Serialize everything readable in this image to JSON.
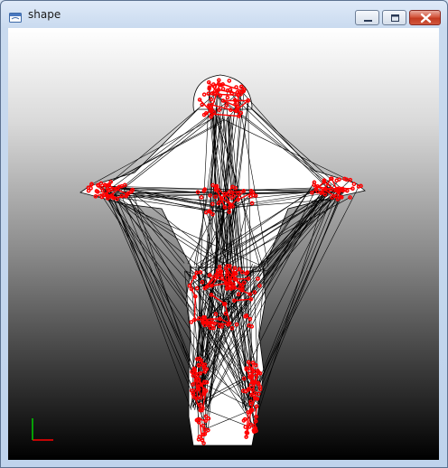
{
  "window": {
    "title": "shape",
    "icon": "app-window-icon",
    "buttons": [
      {
        "name": "minimize",
        "icon": "minimize-icon"
      },
      {
        "name": "maximize",
        "icon": "maximize-icon"
      },
      {
        "name": "close",
        "icon": "close-icon"
      }
    ]
  },
  "viewport": {
    "background_top": "#ffffff",
    "background_bottom": "#000000",
    "mesh_fill": "#ffffff",
    "mesh_edge_color": "#000000",
    "vertex_color": "#ff0000",
    "axis_colors": {
      "x": "#ff0000",
      "y": "#00cc00"
    }
  }
}
